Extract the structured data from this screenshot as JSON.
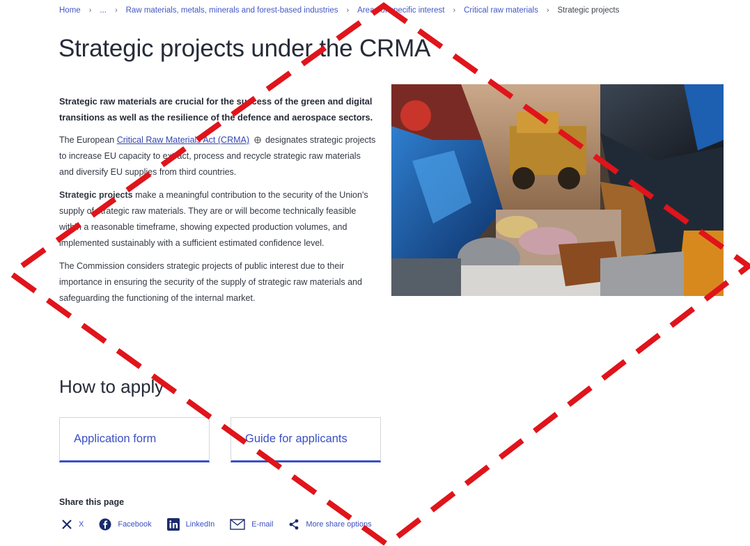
{
  "breadcrumb": {
    "items": [
      "Home",
      "...",
      "Raw materials, metals, minerals and forest-based industries",
      "Areas of specific interest",
      "Critical raw materials"
    ],
    "current": "Strategic projects"
  },
  "page": {
    "title": "Strategic projects under the CRMA"
  },
  "intro": {
    "lead": "Strategic raw materials are crucial for the success of the green and digital transitions as well as the resilience of the defence and aerospace sectors.",
    "p1_before": "The European ",
    "p1_link": "Critical Raw Materials Act (CRMA)",
    "p1_after": " designates strategic projects to increase EU capacity to extract, process and recycle strategic raw materials and diversify EU supplies from third countries.",
    "p2_bold": "Strategic projects",
    "p2_rest": " make a meaningful contribution to the security of the Union's supply of strategic raw materials. They are or will become technically feasible within a reasonable timeframe, showing expected production volumes, and implemented sustainably with a sufficient estimated confidence level.",
    "p3": "The Commission considers strategic projects of public interest due to their importance in ensuring the security of the supply of strategic raw materials and safeguarding the functioning of the internal market."
  },
  "apply": {
    "heading": "How to apply",
    "cards": [
      "Application form",
      "Guide for applicants"
    ]
  },
  "share": {
    "title": "Share this page",
    "items": [
      {
        "label": "X",
        "icon": "x-icon"
      },
      {
        "label": "Facebook",
        "icon": "facebook-icon"
      },
      {
        "label": "LinkedIn",
        "icon": "linkedin-icon"
      },
      {
        "label": "E-mail",
        "icon": "email-icon"
      },
      {
        "label": "More share options",
        "icon": "share-icon"
      }
    ]
  },
  "colors": {
    "accent": "#3a4fc4",
    "overlay_dash": "#e0141b"
  }
}
